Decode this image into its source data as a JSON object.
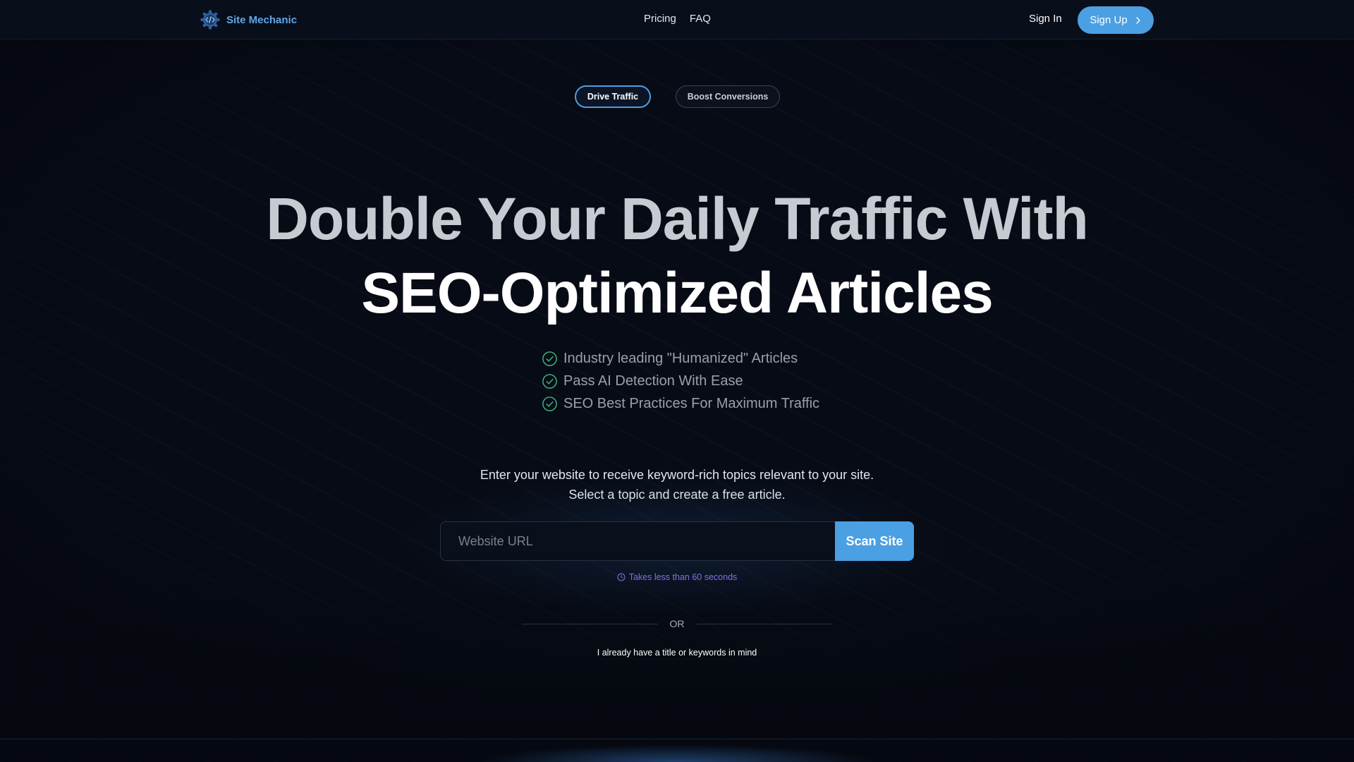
{
  "header": {
    "brand_name": "Site Mechanic",
    "nav": [
      {
        "label": "Pricing"
      },
      {
        "label": "FAQ"
      }
    ],
    "sign_in": "Sign In",
    "sign_up": "Sign Up"
  },
  "tabs": [
    {
      "label": "Drive Traffic",
      "active": true
    },
    {
      "label": "Boost Conversions",
      "active": false
    }
  ],
  "hero": {
    "headline_line1": "Double Your Daily Traffic With",
    "headline_line2": "SEO-Optimized Articles",
    "features": [
      "Industry leading \"Humanized\" Articles",
      "Pass AI Detection With Ease",
      "SEO Best Practices For Maximum Traffic"
    ],
    "lead_line1": "Enter your website to receive keyword-rich topics relevant to your site.",
    "lead_line2": "Select a topic and create a free article."
  },
  "form": {
    "url_placeholder": "Website URL",
    "url_value": "",
    "scan_button": "Scan Site",
    "hint": "Takes less than 60 seconds"
  },
  "divider": {
    "or_text": "OR"
  },
  "alt_link": "I already have a title or keywords in mind",
  "colors": {
    "accent": "#4b9fe3",
    "brand_text": "#5fa8ea",
    "check": "#3fae77",
    "hint": "#8b6fe0",
    "background": "#070b15"
  },
  "icons": {
    "brand": "gear-code-icon",
    "feature": "check-circle-icon",
    "hint": "clock-icon",
    "sign_up": "chevron-right-icon"
  }
}
